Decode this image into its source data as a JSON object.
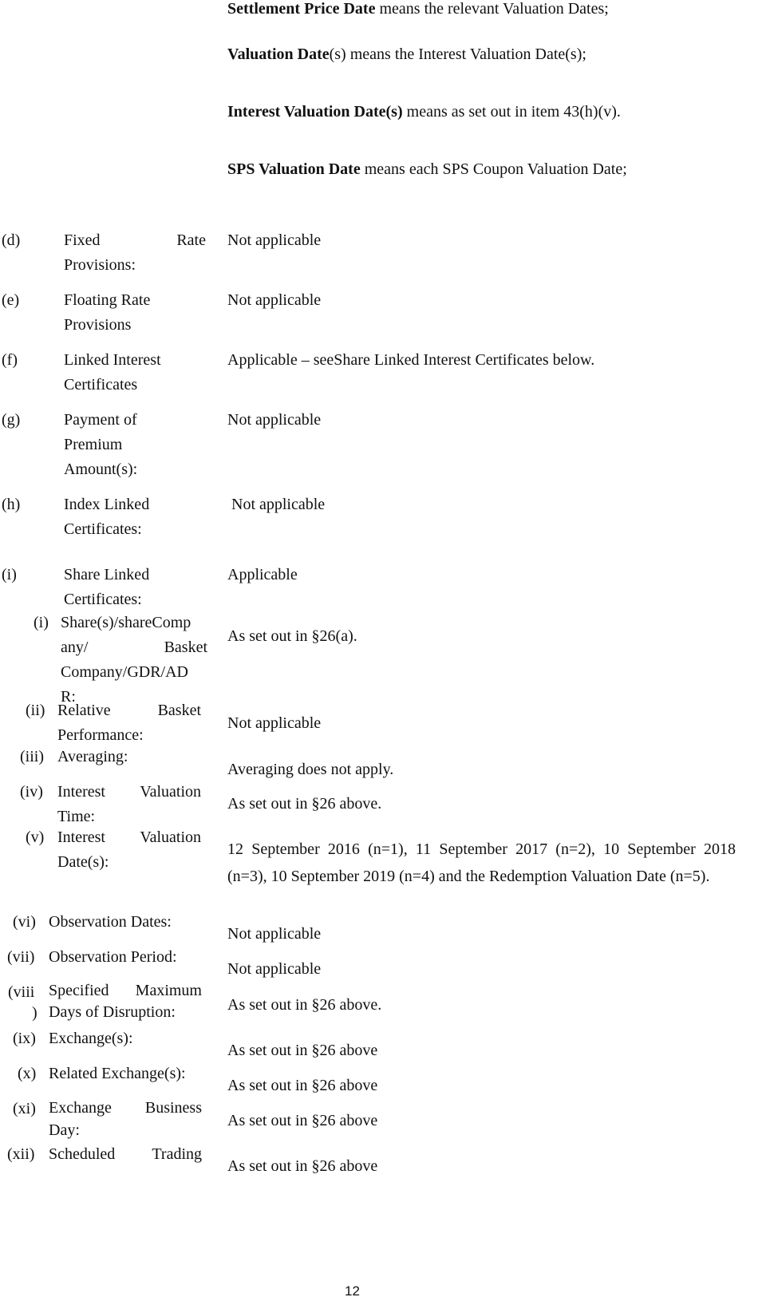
{
  "definitions": [
    {
      "term": "Settlement Price Date",
      "text": " means the relevant Valuation Dates;"
    },
    {
      "term": "Valuation Date",
      "term_rest": "(s)",
      "text": " means the Interest Valuation Date(s);"
    },
    {
      "term": "Interest Valuation Date(s)",
      "text": " means as set out in item 43(h)(v)."
    },
    {
      "term": "SPS Valuation Date",
      "text": " means each SPS Coupon Valuation Date;"
    }
  ],
  "items": [
    {
      "key": "(d)",
      "label_lines": [
        "Fixed Rate",
        "Provisions:"
      ],
      "value": "Not applicable"
    },
    {
      "key": "(e)",
      "label_lines": [
        "Floating Rate",
        "Provisions"
      ],
      "value": "Not applicable"
    },
    {
      "key": "(f)",
      "label_lines": [
        "Linked Interest",
        "Certificates"
      ],
      "value": "Applicable – seeShare Linked Interest Certificates below."
    },
    {
      "key": "(g)",
      "label_lines": [
        "Payment of",
        "Premium",
        "Amount(s):"
      ],
      "value": "Not applicable"
    },
    {
      "key": "(h)",
      "label_lines": [
        "Index Linked",
        "Certificates:"
      ],
      "value": "Not applicable"
    },
    {
      "key": "(i)",
      "label_lines": [
        "Share Linked",
        "Certificates:"
      ],
      "value": "Applicable"
    }
  ],
  "sub_items": [
    {
      "key": "(i)",
      "label_lines": [
        "Share(s)/shareComp",
        "any/ Basket",
        "Company/GDR/AD",
        "R:"
      ],
      "value": "As set out in §26(a)."
    },
    {
      "key": "(ii)",
      "label_lines": [
        "Relative Basket",
        "Performance:"
      ],
      "value": "Not applicable"
    },
    {
      "key": "(iii)",
      "label_lines": [
        "Averaging:"
      ],
      "value": "Averaging does not apply."
    },
    {
      "key": "(iv)",
      "label_lines": [
        "Interest Valuation",
        "Time:"
      ],
      "value": "As set out in §26 above."
    },
    {
      "key": "(v)",
      "label_lines": [
        "Interest Valuation",
        "Date(s):"
      ],
      "value": "12 September 2016 (n=1), 11 September 2017 (n=2), 10 September 2018 (n=3), 10 September 2019 (n=4) and the Redemption Valuation Date (n=5)."
    },
    {
      "key": "(vi)",
      "label_lines": [
        "Observation Dates:"
      ],
      "value": "Not applicable"
    },
    {
      "key": "(vii)",
      "label_lines": [
        "Observation Period:"
      ],
      "value": "Not applicable"
    },
    {
      "key": "(viii",
      "key_cont": ")",
      "label_lines": [
        "Specified Maximum",
        "Days of Disruption:"
      ],
      "value": "As set out in §26 above."
    },
    {
      "key": "(ix)",
      "label_lines": [
        "Exchange(s):"
      ],
      "value": "As set out in §26 above"
    },
    {
      "key": "(x)",
      "label_lines": [
        "Related Exchange(s):"
      ],
      "value": "As set out in §26 above"
    },
    {
      "key": "(xi)",
      "label_lines": [
        "Exchange Business",
        "Day:"
      ],
      "value": "As set out in §26 above"
    },
    {
      "key": "(xii)",
      "label_lines": [
        "Scheduled Trading"
      ],
      "value": "As set out in §26 above"
    }
  ],
  "page_number": "12"
}
